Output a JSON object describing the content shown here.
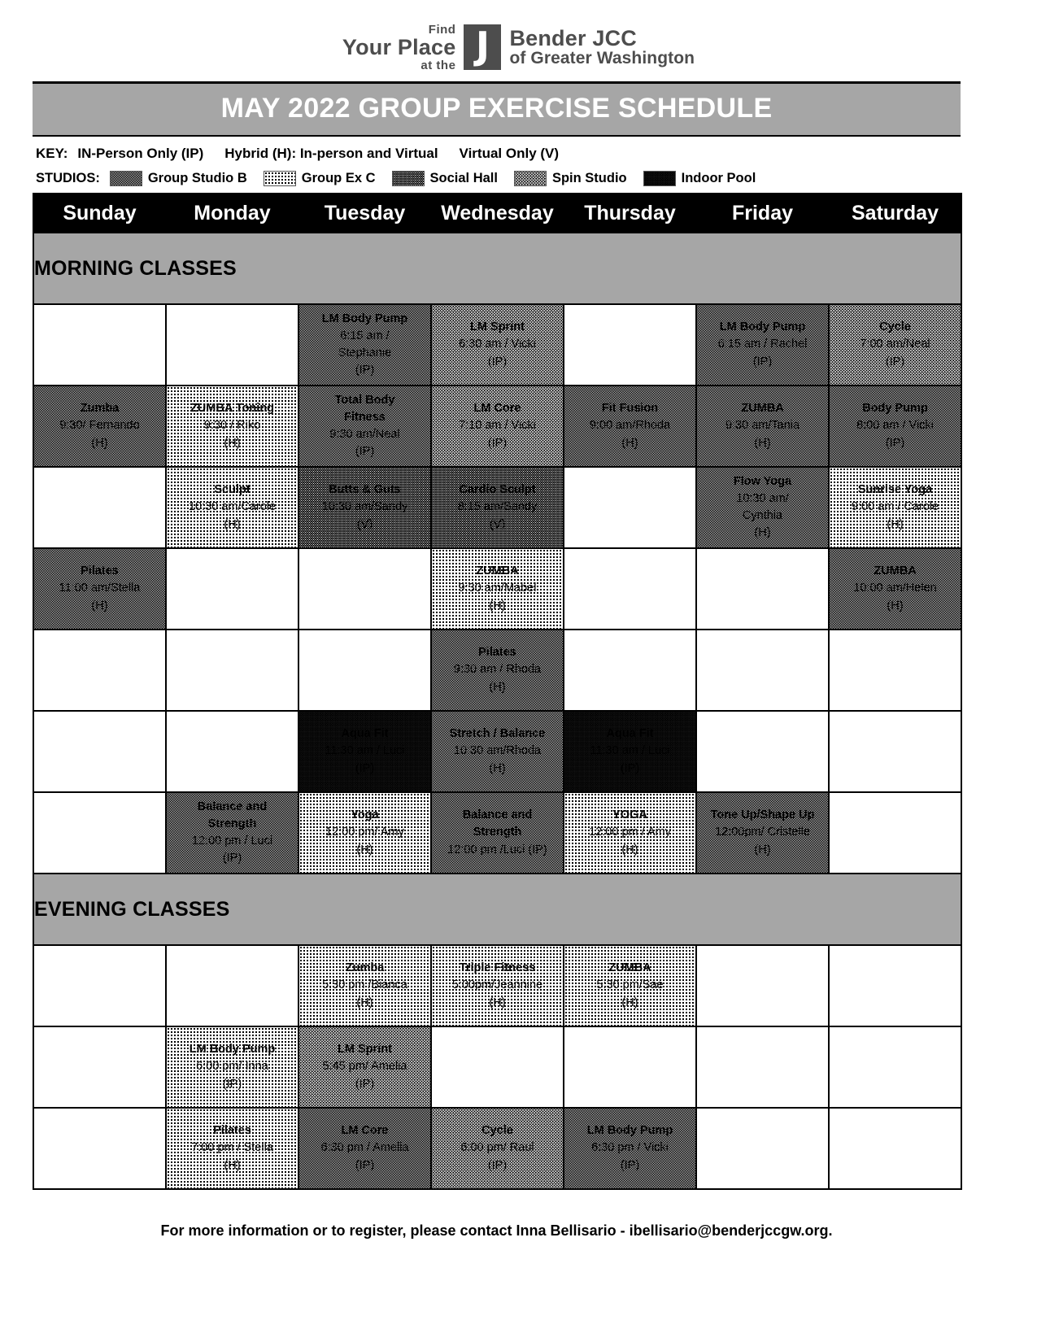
{
  "logo": {
    "line1": "Find",
    "line2": "Your Place",
    "line3": "at the",
    "mark": "J",
    "name": "Bender JCC",
    "subtitle": "of Greater Washington"
  },
  "title": "MAY 2022 GROUP EXERCISE SCHEDULE",
  "key": {
    "label": "KEY:",
    "items": [
      "IN-Person Only (IP)",
      "Hybrid (H): In-person and Virtual",
      "Virtual Only (V)"
    ]
  },
  "studios": {
    "label": "STUDIOS:",
    "items": [
      {
        "name": "Group Studio B",
        "pattern": "pat-b"
      },
      {
        "name": "Group Ex C",
        "pattern": "pat-c"
      },
      {
        "name": "Social Hall",
        "pattern": "pat-sh"
      },
      {
        "name": "Spin Studio",
        "pattern": "pat-spin"
      },
      {
        "name": "Indoor Pool",
        "pattern": "pat-pool"
      }
    ]
  },
  "days": [
    "Sunday",
    "Monday",
    "Tuesday",
    "Wednesday",
    "Thursday",
    "Friday",
    "Saturday"
  ],
  "sections": [
    {
      "label": "MORNING CLASSES"
    },
    {
      "label": "EVENING CLASSES"
    }
  ],
  "footer": "For more information or to register, please contact Inna Bellisario - ibellisario@benderjccgw.org.",
  "colors": {
    "title_bar": "#a6a6a6",
    "section_band": "#a6a6a6",
    "day_header": "#000000",
    "text": "#000000"
  },
  "schedule": {
    "morning": [
      [
        {
          "empty": true
        },
        {
          "empty": true
        },
        {
          "name": "LM Body Pump",
          "detail": "6:15 am /",
          "detail2": "Stephanie",
          "mode": "(IP)",
          "pattern": "pat-b"
        },
        {
          "name": "LM Sprint",
          "detail": "6:30 am / Vicki",
          "mode": "(IP)",
          "pattern": "pat-spin"
        },
        {
          "empty": true
        },
        {
          "name": "LM Body Pump",
          "detail": "6:15 am / Rachel",
          "mode": "(IP)",
          "pattern": "pat-b"
        },
        {
          "name": "Cycle",
          "detail": "7:00 am/Neal",
          "mode": "(IP)",
          "pattern": "pat-spin"
        }
      ],
      [
        {
          "name": "Zumba",
          "detail": "9:30/ Fernando",
          "mode": "(H)",
          "pattern": "pat-b"
        },
        {
          "name": "ZUMBA Toning",
          "detail": "9:30 / Riko",
          "mode": "(H)",
          "pattern": "pat-c"
        },
        {
          "name": "Total Body",
          "name2": "Fitness",
          "detail": "9:30 am/Neal",
          "mode": "(IP)",
          "pattern": "pat-b"
        },
        {
          "name": "LM Core",
          "detail": "7:10 am / Vicki",
          "mode": "(IP)",
          "pattern": "pat-spin"
        },
        {
          "name": "Fit Fusion",
          "detail": "9:00 am/Rhoda",
          "mode": "(H)",
          "pattern": "pat-b"
        },
        {
          "name": "ZUMBA",
          "detail": "9:30 am/Tania",
          "mode": "(H)",
          "pattern": "pat-b"
        },
        {
          "name": "Body Pump",
          "detail": "8:00 am / Vicki",
          "mode": "(IP)",
          "pattern": "pat-b"
        }
      ],
      [
        {
          "empty": true
        },
        {
          "name": "Sculpt",
          "detail": "10:30 am/Carole",
          "mode": "(H)",
          "pattern": "pat-c"
        },
        {
          "name": "Butts & Guts",
          "detail": "10:30 am/Sandy",
          "mode": "(V)",
          "pattern": "pat-sh"
        },
        {
          "name": "Cardio Sculpt",
          "detail": "8:15 am/Sandy",
          "mode": "(V)",
          "pattern": "pat-sh"
        },
        {
          "empty": true
        },
        {
          "name": "Flow Yoga",
          "detail": "10:30 am/",
          "detail2": "Cynthia",
          "mode": "(H)",
          "pattern": "pat-b"
        },
        {
          "name": "Sunrise Yoga",
          "detail": "9:00 am / Carole",
          "mode": "(H)",
          "pattern": "pat-c"
        }
      ],
      [
        {
          "name": "Pilates",
          "detail": "11:00 am/Stella",
          "mode": "(H)",
          "pattern": "pat-b"
        },
        {
          "empty": true
        },
        {
          "empty": true
        },
        {
          "name": "ZUMBA",
          "detail": "9:30 am/Mabel",
          "mode": "(H)",
          "pattern": "pat-c"
        },
        {
          "empty": true
        },
        {
          "empty": true
        },
        {
          "name": "ZUMBA",
          "detail": "10:00 am/Helen",
          "mode": "(H)",
          "pattern": "pat-b"
        }
      ],
      [
        {
          "empty": true
        },
        {
          "empty": true
        },
        {
          "empty": true
        },
        {
          "name": "Pilates",
          "detail": "9:30 am / Rhoda",
          "mode": "(H)",
          "pattern": "pat-b"
        },
        {
          "empty": true
        },
        {
          "empty": true
        },
        {
          "empty": true
        }
      ],
      [
        {
          "empty": true
        },
        {
          "empty": true
        },
        {
          "name": "Aqua Fit",
          "detail": "11:30 am / Luci",
          "mode": "(IP)",
          "pattern": "pat-pool"
        },
        {
          "name": "Stretch / Balance",
          "detail": "10:30 am/Rhoda",
          "mode": "(H)",
          "pattern": "pat-b"
        },
        {
          "name": "Aqua Fit",
          "detail": "11:30 am / Luci",
          "mode": "(IP)",
          "pattern": "pat-pool"
        },
        {
          "empty": true
        },
        {
          "empty": true
        }
      ],
      [
        {
          "empty": true
        },
        {
          "name": "Balance and",
          "name2": "Strength",
          "detail": "12:00 pm / Luci",
          "mode": "(IP)",
          "pattern": "pat-b"
        },
        {
          "name": "Yoga",
          "detail": "12:00 pm/ Amy",
          "mode": "(H)",
          "pattern": "pat-c"
        },
        {
          "name": "Balance and",
          "name2": "Strength",
          "detail": "12:00 pm /Luci (IP)",
          "pattern": "pat-b"
        },
        {
          "name": "YOGA",
          "detail": "12:00 pm / Amy",
          "mode": "(H)",
          "pattern": "pat-c"
        },
        {
          "name": "Tone Up/Shape Up",
          "detail": "12:00pm/ Cristelle",
          "mode": "(H)",
          "pattern": "pat-b"
        },
        {
          "empty": true
        }
      ]
    ],
    "evening": [
      [
        {
          "empty": true
        },
        {
          "empty": true
        },
        {
          "name": "Zumba",
          "detail": "5:30 pm /Bianca",
          "mode": "(H)",
          "pattern": "pat-c"
        },
        {
          "name": "Triple Fitness",
          "detail": "5:00pm/Jeannine",
          "mode": "(H)",
          "pattern": "pat-c"
        },
        {
          "name": "ZUMBA",
          "detail": "5:30 pm/Sae",
          "mode": "(H)",
          "pattern": "pat-c"
        },
        {
          "empty": true
        },
        {
          "empty": true
        }
      ],
      [
        {
          "empty": true
        },
        {
          "name": "LM Body Pump",
          "detail": "6:00 pm/ Inna",
          "mode": "(IP)",
          "pattern": "pat-c"
        },
        {
          "name": "LM Sprint",
          "detail": "5:45 pm/ Amelia",
          "mode": "(IP)",
          "pattern": "pat-spin"
        },
        {
          "empty": true
        },
        {
          "empty": true
        },
        {
          "empty": true
        },
        {
          "empty": true
        }
      ],
      [
        {
          "empty": true
        },
        {
          "name": "Pilates",
          "detail": "7:00 pm / Stella",
          "mode": "(H)",
          "pattern": "pat-c"
        },
        {
          "name": "LM Core",
          "detail": "6:30 pm / Amelia",
          "mode": "(IP)",
          "pattern": "pat-b"
        },
        {
          "name": "Cycle",
          "detail": "6:00 pm/ Raul",
          "mode": "(IP)",
          "pattern": "pat-spin"
        },
        {
          "name": "LM Body Pump",
          "detail": "6:30 pm / Vicki",
          "mode": "(IP)",
          "pattern": "pat-b"
        },
        {
          "empty": true
        },
        {
          "empty": true
        }
      ]
    ]
  }
}
